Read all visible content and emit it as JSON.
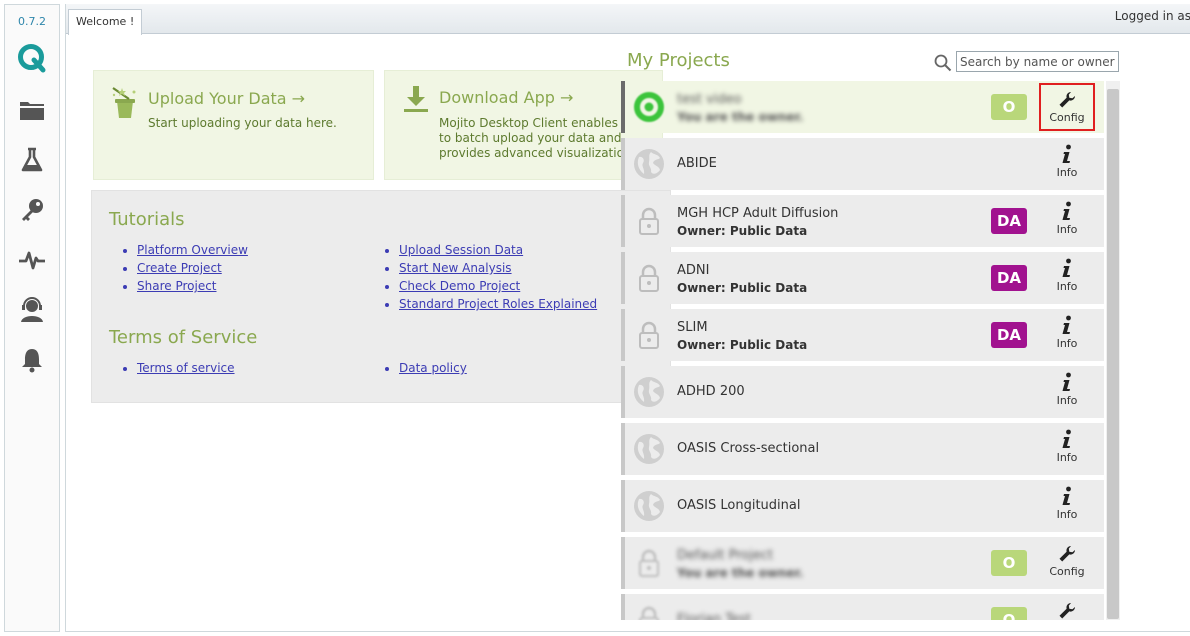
{
  "sidebar": {
    "version": "0.7.2",
    "icons": [
      "q-logo-icon",
      "folder-icon",
      "flask-icon",
      "key-icon",
      "pulse-icon",
      "support-icon",
      "bell-icon"
    ]
  },
  "tab": {
    "label": "Welcome !"
  },
  "header": {
    "logged_in": "Logged in as"
  },
  "upload": {
    "title": "Upload Your Data →",
    "text": "Start uploading your data here."
  },
  "download": {
    "title": "Download App →",
    "text_lines": [
      "Mojito Desktop Client enables you",
      "to batch upload your data and",
      "provides advanced visualization"
    ]
  },
  "tutorials": {
    "title": "Tutorials",
    "left": [
      "Platform Overview",
      "Create Project",
      "Share Project"
    ],
    "right": [
      "Upload Session Data",
      "Start New Analysis",
      "Check Demo Project",
      "Standard Project Roles Explained"
    ]
  },
  "terms": {
    "title": "Terms of Service",
    "left": [
      "Terms of service"
    ],
    "right": [
      "Data policy"
    ]
  },
  "projects": {
    "title": "My Projects",
    "search_placeholder": "Search by name or owner",
    "items": [
      {
        "name": "test video",
        "owner": "You are the owner.",
        "badge": "O",
        "action": "Config",
        "icon": "active-ring-icon",
        "blurred": true
      },
      {
        "name": "ABIDE",
        "owner": "",
        "badge": "",
        "action": "Info",
        "icon": "globe-icon",
        "blurred": false
      },
      {
        "name": "MGH HCP Adult Diffusion",
        "owner": "Owner: Public Data",
        "badge": "DA",
        "action": "Info",
        "icon": "lock-icon",
        "blurred": false
      },
      {
        "name": "ADNI",
        "owner": "Owner: Public Data",
        "badge": "DA",
        "action": "Info",
        "icon": "lock-icon",
        "blurred": false
      },
      {
        "name": "SLIM",
        "owner": "Owner: Public Data",
        "badge": "DA",
        "action": "Info",
        "icon": "lock-icon",
        "blurred": false
      },
      {
        "name": "ADHD 200",
        "owner": "",
        "badge": "",
        "action": "Info",
        "icon": "globe-icon",
        "blurred": false
      },
      {
        "name": "OASIS Cross-sectional",
        "owner": "",
        "badge": "",
        "action": "Info",
        "icon": "globe-icon",
        "blurred": false
      },
      {
        "name": "OASIS Longitudinal",
        "owner": "",
        "badge": "",
        "action": "Info",
        "icon": "globe-icon",
        "blurred": false
      },
      {
        "name": "Default Project",
        "owner": "You are the owner.",
        "badge": "O",
        "action": "Config",
        "icon": "lock-icon",
        "blurred": true
      },
      {
        "name": "Florian Test",
        "owner": "",
        "badge": "O",
        "action": "",
        "icon": "lock-icon",
        "blurred": true
      }
    ]
  },
  "colors": {
    "accent_green": "#8aa84f",
    "card_bg": "#f1f6e4",
    "badge_owner": "#b9d77a",
    "badge_da": "#a1128f",
    "highlight": "#e01f1f"
  }
}
